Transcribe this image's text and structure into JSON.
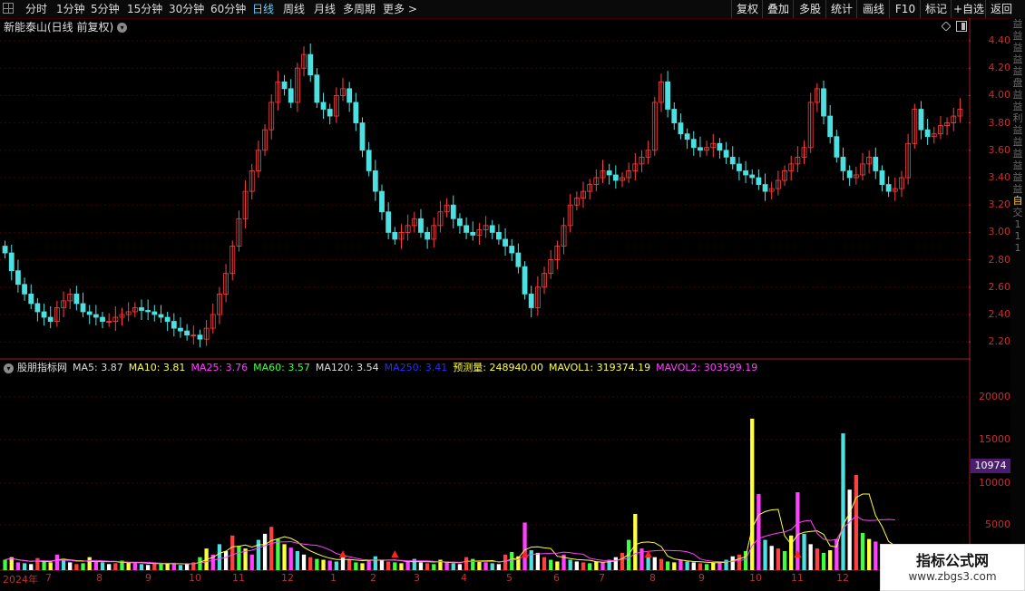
{
  "toolbar": {
    "left": [
      "分时",
      "1分钟",
      "5分钟",
      "15分钟",
      "30分钟",
      "60分钟",
      "日线",
      "周线",
      "月线",
      "多周期",
      "更多 >"
    ],
    "active": "日线",
    "right": [
      "复权",
      "叠加",
      "多股",
      "统计",
      "画线",
      "F10",
      "标记",
      "+自选",
      "返回"
    ]
  },
  "chart_title": "新能泰山(日线 前复权)",
  "price_axis": {
    "ticks": [
      "4.40",
      "4.20",
      "4.00",
      "3.80",
      "3.60",
      "3.40",
      "3.20",
      "3.00",
      "2.80",
      "2.60",
      "2.40",
      "2.20"
    ]
  },
  "volume_axis": {
    "ticks": [
      "20000",
      "15000",
      "10000",
      "5000"
    ],
    "current_box": "10974"
  },
  "indicator": {
    "name": "股朋指标网",
    "items": [
      {
        "label": "MA5: 3.87",
        "color": "#dcdcdc"
      },
      {
        "label": "MA10: 3.81",
        "color": "#ffff40"
      },
      {
        "label": "MA25: 3.76",
        "color": "#ff40ff"
      },
      {
        "label": "MA60: 3.57",
        "color": "#40ff40"
      },
      {
        "label": "MA120: 3.54",
        "color": "#dcdcdc"
      },
      {
        "label": "MA250: 3.41",
        "color": "#2b2bff"
      },
      {
        "label": "预测量: 248940.00",
        "color": "#ffff40"
      },
      {
        "label": "MAVOL1: 319374.19",
        "color": "#ffff40"
      },
      {
        "label": "MAVOL2: 303599.19",
        "color": "#ff40ff"
      }
    ]
  },
  "months": [
    "2024年",
    "7",
    "8",
    "9",
    "10",
    "11",
    "12",
    "1",
    "2",
    "3",
    "4",
    "5",
    "6",
    "7",
    "8",
    "9",
    "10",
    "11",
    "12"
  ],
  "right_column": [
    "益",
    "益",
    "益",
    "益",
    "益",
    "盘",
    "益",
    "益",
    "利",
    "益",
    "益",
    "益",
    "益",
    "益",
    "益",
    "自",
    "交",
    "1",
    "1",
    "1"
  ],
  "watermark": {
    "line1": "指标公式网",
    "line2": "www.zbgs3.com"
  },
  "colors": {
    "up": "#ff4040",
    "down": "#4ce0e0",
    "grid": "#5a0000",
    "axis": "#c03030"
  },
  "chart_data": {
    "type": "candlestick",
    "title": "新能泰山(日线 前复权)",
    "ylim": [
      2.15,
      4.45
    ],
    "close": [
      2.85,
      2.72,
      2.62,
      2.55,
      2.48,
      2.42,
      2.38,
      2.35,
      2.45,
      2.5,
      2.55,
      2.48,
      2.42,
      2.4,
      2.38,
      2.35,
      2.35,
      2.38,
      2.4,
      2.42,
      2.45,
      2.43,
      2.42,
      2.4,
      2.38,
      2.35,
      2.3,
      2.28,
      2.25,
      2.25,
      2.22,
      2.3,
      2.4,
      2.55,
      2.7,
      2.9,
      3.1,
      3.3,
      3.45,
      3.6,
      3.75,
      3.95,
      4.1,
      4.05,
      3.95,
      4.2,
      4.3,
      4.15,
      3.95,
      3.9,
      3.85,
      4.0,
      4.05,
      3.95,
      3.8,
      3.6,
      3.45,
      3.3,
      3.15,
      3.0,
      2.95,
      3.0,
      3.05,
      3.1,
      3.0,
      2.95,
      3.05,
      3.15,
      3.2,
      3.1,
      3.05,
      3.0,
      2.98,
      3.02,
      3.05,
      3.0,
      2.95,
      2.9,
      2.85,
      2.75,
      2.55,
      2.45,
      2.6,
      2.7,
      2.8,
      2.9,
      3.05,
      3.2,
      3.25,
      3.3,
      3.35,
      3.4,
      3.45,
      3.42,
      3.38,
      3.4,
      3.45,
      3.5,
      3.55,
      3.6,
      3.95,
      4.1,
      3.9,
      3.8,
      3.72,
      3.68,
      3.62,
      3.6,
      3.62,
      3.65,
      3.6,
      3.55,
      3.5,
      3.45,
      3.42,
      3.4,
      3.35,
      3.3,
      3.32,
      3.38,
      3.45,
      3.5,
      3.55,
      3.62,
      3.95,
      4.05,
      3.85,
      3.7,
      3.55,
      3.45,
      3.4,
      3.42,
      3.5,
      3.55,
      3.45,
      3.35,
      3.3,
      3.32,
      3.4,
      3.65,
      3.9,
      3.75,
      3.7,
      3.72,
      3.78,
      3.8,
      3.85,
      3.9
    ],
    "volume": [
      1200,
      1500,
      900,
      800,
      700,
      1400,
      1100,
      900,
      1800,
      1200,
      900,
      700,
      800,
      1500,
      1000,
      900,
      700,
      800,
      1100,
      900,
      800,
      700,
      600,
      900,
      700,
      800,
      700,
      600,
      700,
      900,
      1500,
      2500,
      1800,
      3000,
      2200,
      4000,
      2800,
      2500,
      1800,
      3500,
      4200,
      5000,
      3600,
      3000,
      2600,
      2200,
      1800,
      1500,
      1300,
      1200,
      1100,
      1000,
      1500,
      1300,
      900,
      800,
      1200,
      1600,
      1200,
      1000,
      900,
      800,
      1000,
      1300,
      900,
      800,
      700,
      1200,
      900,
      800,
      700,
      1500,
      1300,
      1000,
      900,
      800,
      700,
      1800,
      2100,
      1600,
      5500,
      2300,
      2000,
      1500,
      1200,
      1000,
      1800,
      1200,
      1000,
      900,
      800,
      1000,
      900,
      1200,
      1500,
      2000,
      3500,
      6500,
      2500,
      1800,
      1500,
      1300,
      1000,
      900,
      1200,
      1000,
      900,
      800,
      700,
      900,
      1000,
      1200,
      1600,
      1800,
      2200,
      17500,
      8800,
      3500,
      2800,
      2500,
      2200,
      4000,
      9000,
      4200,
      3000,
      2500,
      2000,
      2300,
      3600,
      15800,
      9300,
      11000,
      4300,
      3600,
      3300,
      3000,
      2400,
      1800
    ]
  }
}
